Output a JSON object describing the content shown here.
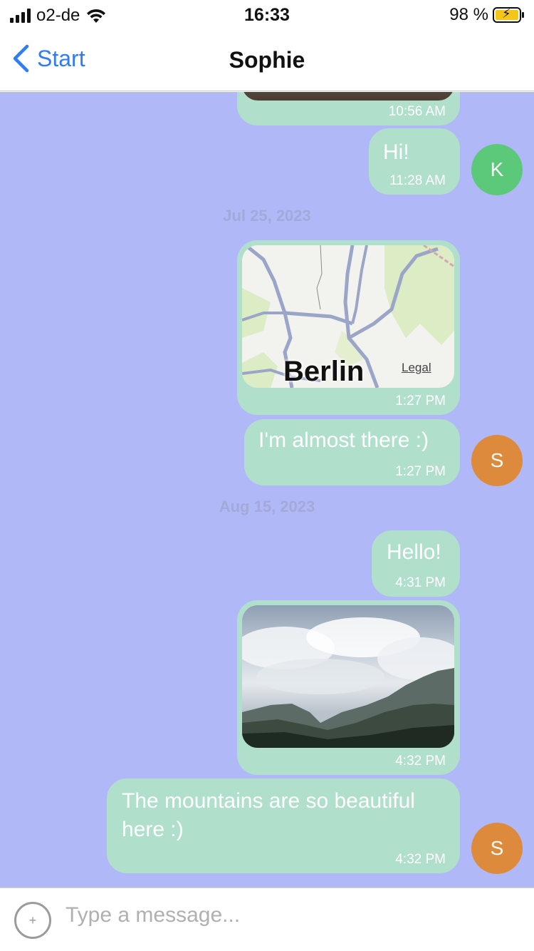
{
  "status_bar": {
    "carrier": "o2-de",
    "time": "16:33",
    "battery": "98 %",
    "battery_level": 0.98
  },
  "nav": {
    "back_label": "Start",
    "title": "Sophie"
  },
  "colors": {
    "chat_background": "#b0b8f7",
    "bubble": "#b0dfcc",
    "accent": "#2f7cf6",
    "avatar_k": "#5cc97a",
    "avatar_s": "#de8a3c"
  },
  "messages": [
    {
      "type": "image",
      "time": "10:56 AM"
    },
    {
      "type": "text",
      "text": "Hi!",
      "time": "11:28 AM",
      "avatar": "K"
    },
    {
      "type": "date",
      "text": "Jul 25, 2023"
    },
    {
      "type": "map",
      "map_label": "Berlin",
      "legal": "Legal",
      "time": "1:27 PM"
    },
    {
      "type": "text",
      "text": "I'm almost there :)",
      "time": "1:27 PM",
      "avatar": "S"
    },
    {
      "type": "date",
      "text": "Aug 15, 2023"
    },
    {
      "type": "text",
      "text": "Hello!",
      "time": "4:31 PM"
    },
    {
      "type": "image",
      "time": "4:32 PM"
    },
    {
      "type": "text",
      "text": "The mountains are so beautiful here :)",
      "time": "4:32 PM",
      "avatar": "S"
    }
  ],
  "input": {
    "add_icon": "+",
    "placeholder": "Type a message..."
  }
}
